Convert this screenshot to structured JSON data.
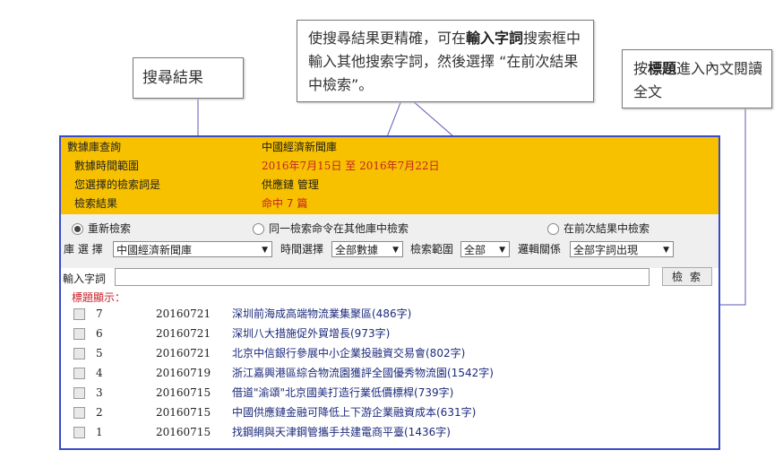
{
  "callouts": {
    "results": "搜尋結果",
    "refine_a": "使搜尋結果更精確，可在",
    "refine_b": "輸入字詞",
    "refine_c": "搜索框中輸入其他搜索字詞，然後選擇 “在前次結果中檢索”。",
    "title_a": "按",
    "title_b": "標題",
    "title_c": "進入內文閱讀全文"
  },
  "info": {
    "db_label": "數據庫查詢",
    "db_value": "中國經濟新聞庫",
    "range_label": "數據時間範圍",
    "range_value": "2016年7月15日 至 2016年7月22日",
    "term_label": "您選擇的檢索詞是",
    "term_value": "供應鏈 管理",
    "result_label": "檢索結果",
    "result_prefix": "命中",
    "result_count": "7",
    "result_suffix": "篇"
  },
  "search": {
    "radio_new": "重新檢索",
    "radio_other": "同一檢索命令在其他庫中檢索",
    "radio_prev": "在前次結果中檢索",
    "lib_label": "庫 選 擇",
    "lib_value": "中國經濟新聞庫",
    "time_label": "時間選擇",
    "time_value": "全部數據",
    "scope_label": "檢索範圍",
    "scope_value": "全部",
    "logic_label": "邏輯關係",
    "logic_value": "全部字詞出現",
    "keyword_label": "輸入字詞",
    "keyword_value": "",
    "search_button": "檢索"
  },
  "list": {
    "header": "標題顯示：",
    "items": [
      {
        "num": "7",
        "date": "20160721",
        "title": "深圳前海成高端物流業集聚區(486字)"
      },
      {
        "num": "6",
        "date": "20160721",
        "title": "深圳八大措施促外貿增長(973字)"
      },
      {
        "num": "5",
        "date": "20160721",
        "title": "北京中信銀行參展中小企業投融資交易會(802字)"
      },
      {
        "num": "4",
        "date": "20160719",
        "title": "浙江嘉興港區綜合物流園獲評全國優秀物流園(1542字)"
      },
      {
        "num": "3",
        "date": "20160715",
        "title": "借道\"渝頌\"北京國美打造行業低價標桿(739字)"
      },
      {
        "num": "2",
        "date": "20160715",
        "title": "中國供應鏈金融可降低上下游企業融資成本(631字)"
      },
      {
        "num": "1",
        "date": "20160715",
        "title": "找鋼網與天津鋼管攜手共建電商平臺(1436字)"
      }
    ]
  }
}
